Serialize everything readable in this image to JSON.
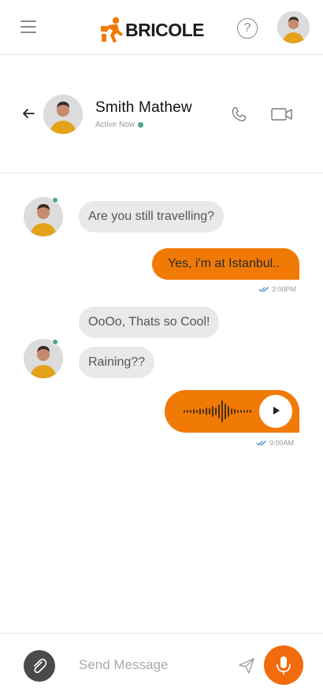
{
  "app": {
    "brand": "BRICOLE",
    "brand_color": "#f07a05"
  },
  "appbar": {
    "menu_icon": "hamburger-icon",
    "help_icon": "question-circle-icon",
    "help_glyph": "?"
  },
  "contact": {
    "name": "Smith Mathew",
    "status": "Active Now",
    "online_color": "#46a894"
  },
  "header_actions": {
    "call_icon": "phone-icon",
    "video_icon": "video-camera-icon"
  },
  "messages": [
    {
      "from": "them",
      "text": "Are you still travelling?"
    },
    {
      "from": "me",
      "text": "Yes, i'm at Istanbul..",
      "time": "3:00PM"
    },
    {
      "from": "them",
      "text": "OoOo, Thats so Cool!"
    },
    {
      "from": "them",
      "text": "Raining??"
    },
    {
      "from": "me",
      "type": "voice",
      "time": "9:00AM"
    }
  ],
  "composer": {
    "placeholder": "Send Message",
    "attach_icon": "paperclip-icon",
    "send_icon": "send-icon",
    "mic_icon": "microphone-icon"
  }
}
